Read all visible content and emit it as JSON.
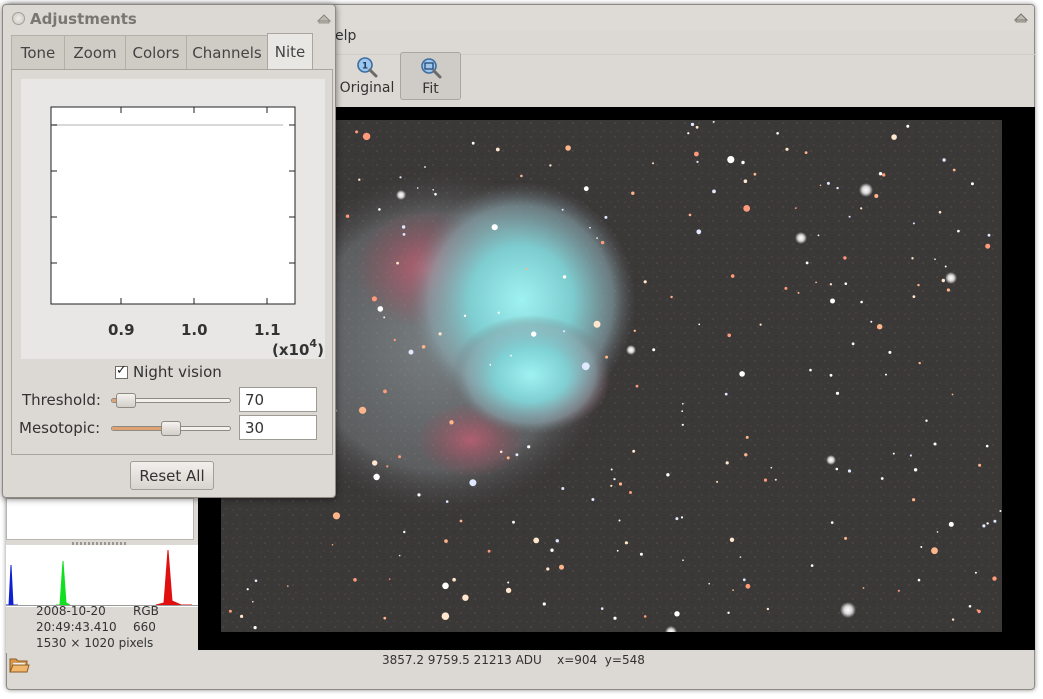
{
  "main_window": {
    "menu_help_partial": "elp",
    "toolbar": {
      "original_label": "Original",
      "fit_label": "Fit",
      "fit_active": true
    },
    "status": {
      "values": "3857.2 9759.5 21213 ADU",
      "coords": "x=904  y=548"
    }
  },
  "image_info": {
    "date": "2008-10-20",
    "time": "20:49:43.410",
    "mode": "RGB",
    "exposure": "660",
    "dimensions": "1530 × 1020 pixels"
  },
  "adjustments": {
    "title": "Adjustments",
    "tabs": [
      {
        "label": "Tone",
        "active": false
      },
      {
        "label": "Zoom",
        "active": false
      },
      {
        "label": "Colors",
        "active": false
      },
      {
        "label": "Channels",
        "active": false
      },
      {
        "label": "Nite",
        "active": true
      }
    ],
    "plot": {
      "xticks": [
        "0.9",
        "1.0",
        "1.1"
      ],
      "x_multiplier": "(x10",
      "x_multiplier_exp": "4"
    },
    "night_vision": {
      "label": "Night vision",
      "checked": true
    },
    "threshold": {
      "label": "Threshold:",
      "value": "70",
      "slider_fraction": 0.04
    },
    "mesotopic": {
      "label": "Mesotopic:",
      "value": "30",
      "slider_fraction": 0.5
    },
    "reset_label": "Reset All"
  },
  "histogram_colors": {
    "blue": "#1020d0",
    "green": "#10e020",
    "red": "#e01010"
  },
  "icons": {
    "original": "zoom-1to1-icon",
    "fit": "zoom-fit-icon",
    "open": "folder-open-icon"
  }
}
